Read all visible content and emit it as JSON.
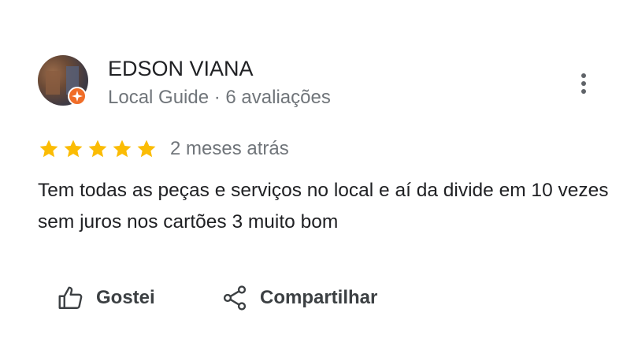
{
  "reviewer": {
    "name": "EDSON VIANA",
    "meta": "Local Guide · 6 avaliações",
    "avatar_icon": "user-photo",
    "badge_icon": "local-guide-badge-icon",
    "badge_color": "#f06d28"
  },
  "review": {
    "rating": 5,
    "rating_max": 5,
    "star_color": "#fbbc04",
    "date": "2 meses atrás",
    "text": "Tem todas as peças e serviços no local e aí da divide em 10 vezes sem juros nos cartões 3 muito bom"
  },
  "actions": {
    "more_icon": "more-vertical-icon",
    "like_label": "Gostei",
    "like_icon": "thumb-up-icon",
    "share_label": "Compartilhar",
    "share_icon": "share-icon"
  }
}
